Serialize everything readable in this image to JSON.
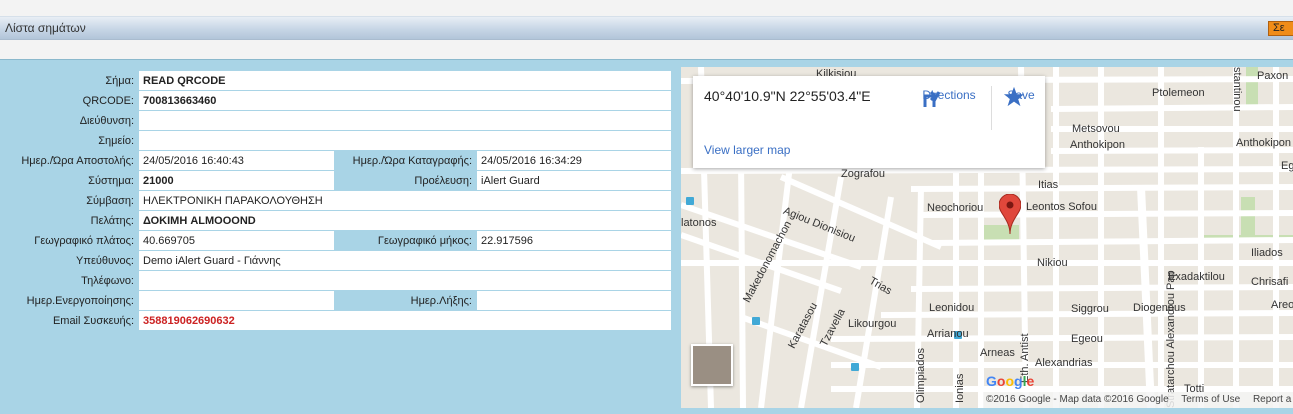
{
  "window": {
    "title": "Λίστα σημάτων",
    "corner_button": "Σε"
  },
  "details": {
    "rows": [
      {
        "label": "Σήμα:",
        "value": "READ QRCODE"
      },
      {
        "label": "QRCODE:",
        "value": "700813663460"
      },
      {
        "label": "Διεύθυνση:",
        "value": ""
      },
      {
        "label": "Σημείο:",
        "value": ""
      },
      {
        "label": "Ημερ./Ώρα Αποστολής:",
        "value": "24/05/2016 16:40:43",
        "label2": "Ημερ./Ώρα Καταγραφής:",
        "value2": "24/05/2016 16:34:29"
      },
      {
        "label": "Σύστημα:",
        "value": "21000",
        "label2": "Προέλευση:",
        "value2": "iAlert Guard"
      },
      {
        "label": "Σύμβαση:",
        "value": "ΗΛΕΚΤΡΟΝΙΚΗ ΠΑΡΑΚΟΛΟΥΘΗΣΗ"
      },
      {
        "label": "Πελάτης:",
        "value": "ΔΟΚΙΜΗ ALMOOOND"
      },
      {
        "label": "Γεωγραφικό πλάτος:",
        "value": "40.669705",
        "label2": "Γεωγραφικό μήκος:",
        "value2": "22.917596"
      },
      {
        "label": "Υπεύθυνος:",
        "value": "Demo iAlert Guard - Γιάννης"
      },
      {
        "label": "Τηλέφωνο:",
        "value": ""
      },
      {
        "label": "Ημερ.Ενεργοποίησης:",
        "value": "",
        "label2": "Ημερ.Λήξης:",
        "value2": ""
      },
      {
        "label": "Email Συσκευής:",
        "value": "358819062690632"
      }
    ]
  },
  "map": {
    "info": {
      "coords": "40°40'10.9\"N 22°55'03.4\"E",
      "directions": "Directions",
      "save": "Save",
      "view_larger": "View larger map"
    },
    "streets": {
      "kilkisiou": "Kilkisiou",
      "stantinou": "stantinou",
      "paxon": "Paxon",
      "ptolemeon": "Ptolemeon",
      "metsovou": "Metsovou",
      "anthokipon": "Anthokipon",
      "anthokipon2": "Anthokipon",
      "eg": "Eg",
      "zografou": "Zografou",
      "itias": "Itias",
      "neochoriou": "Neochoriou",
      "leontos": "Leontos Sofou",
      "agiou": "Agiou Dionisiou",
      "atonos": "latonos",
      "makedonomachon": "Makedonomachon",
      "iliados": "Iliados",
      "nikiou": "Nikiou",
      "exadaktilou": "Exadaktilou",
      "chrisafi": "Chrisafi",
      "trias": "Trias",
      "karatasou": "Karatasou",
      "leonidou": "Leonidou",
      "siggrou": "Siggrou",
      "diogenous": "Diogenous",
      "areos": "Areos",
      "tzavella": "Tzavella",
      "likourgou": "Likourgou",
      "arrianou": "Arrianou",
      "egeou": "Egeou",
      "stratarchou": "Stratarchou Alexandrou Pap",
      "olimpiados": "Olimpiados",
      "arneas": "Arneas",
      "alexandrias": "Alexandrias",
      "eth": "Eth. Antist",
      "ionias": "Ionias",
      "totti": "Totti"
    },
    "google_logo": [
      "G",
      "o",
      "o",
      "g",
      "l",
      "e"
    ],
    "footer": {
      "copyright": "©2016 Google - Map data ©2016 Google",
      "terms": "Terms of Use",
      "report": "Report a map error"
    },
    "colors": {
      "land": "#ebe7df",
      "road": "#ffffff",
      "park": "#c8dfb3",
      "pin": "#e0473b",
      "link": "#3a6fc4"
    }
  }
}
